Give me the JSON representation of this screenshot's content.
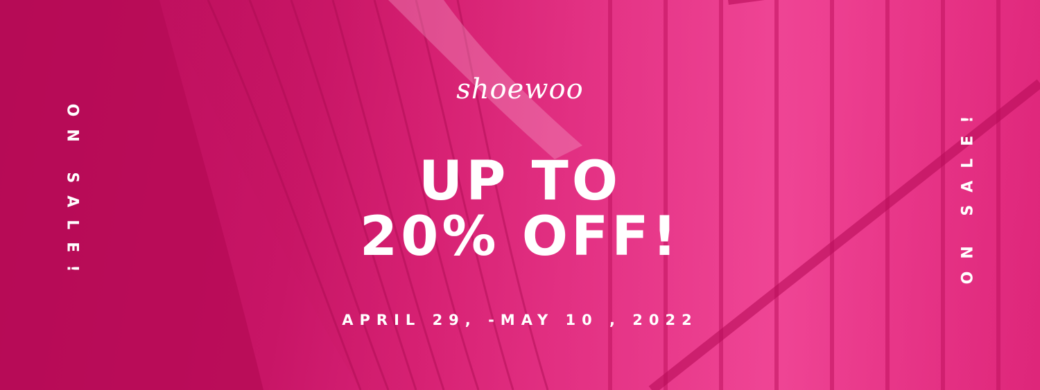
{
  "banner": {
    "brand": "shoewoo",
    "headline_line1": "UP TO",
    "headline_line2": "20% OFF!",
    "dates": "APRIL 29, -MAY 10 , 2022",
    "side_left": "ON SALE!",
    "side_right": "ON SALE!",
    "colors": {
      "background": "#c4145e",
      "overlay_light": "#ee3a8e",
      "text": "#ffffff"
    }
  }
}
